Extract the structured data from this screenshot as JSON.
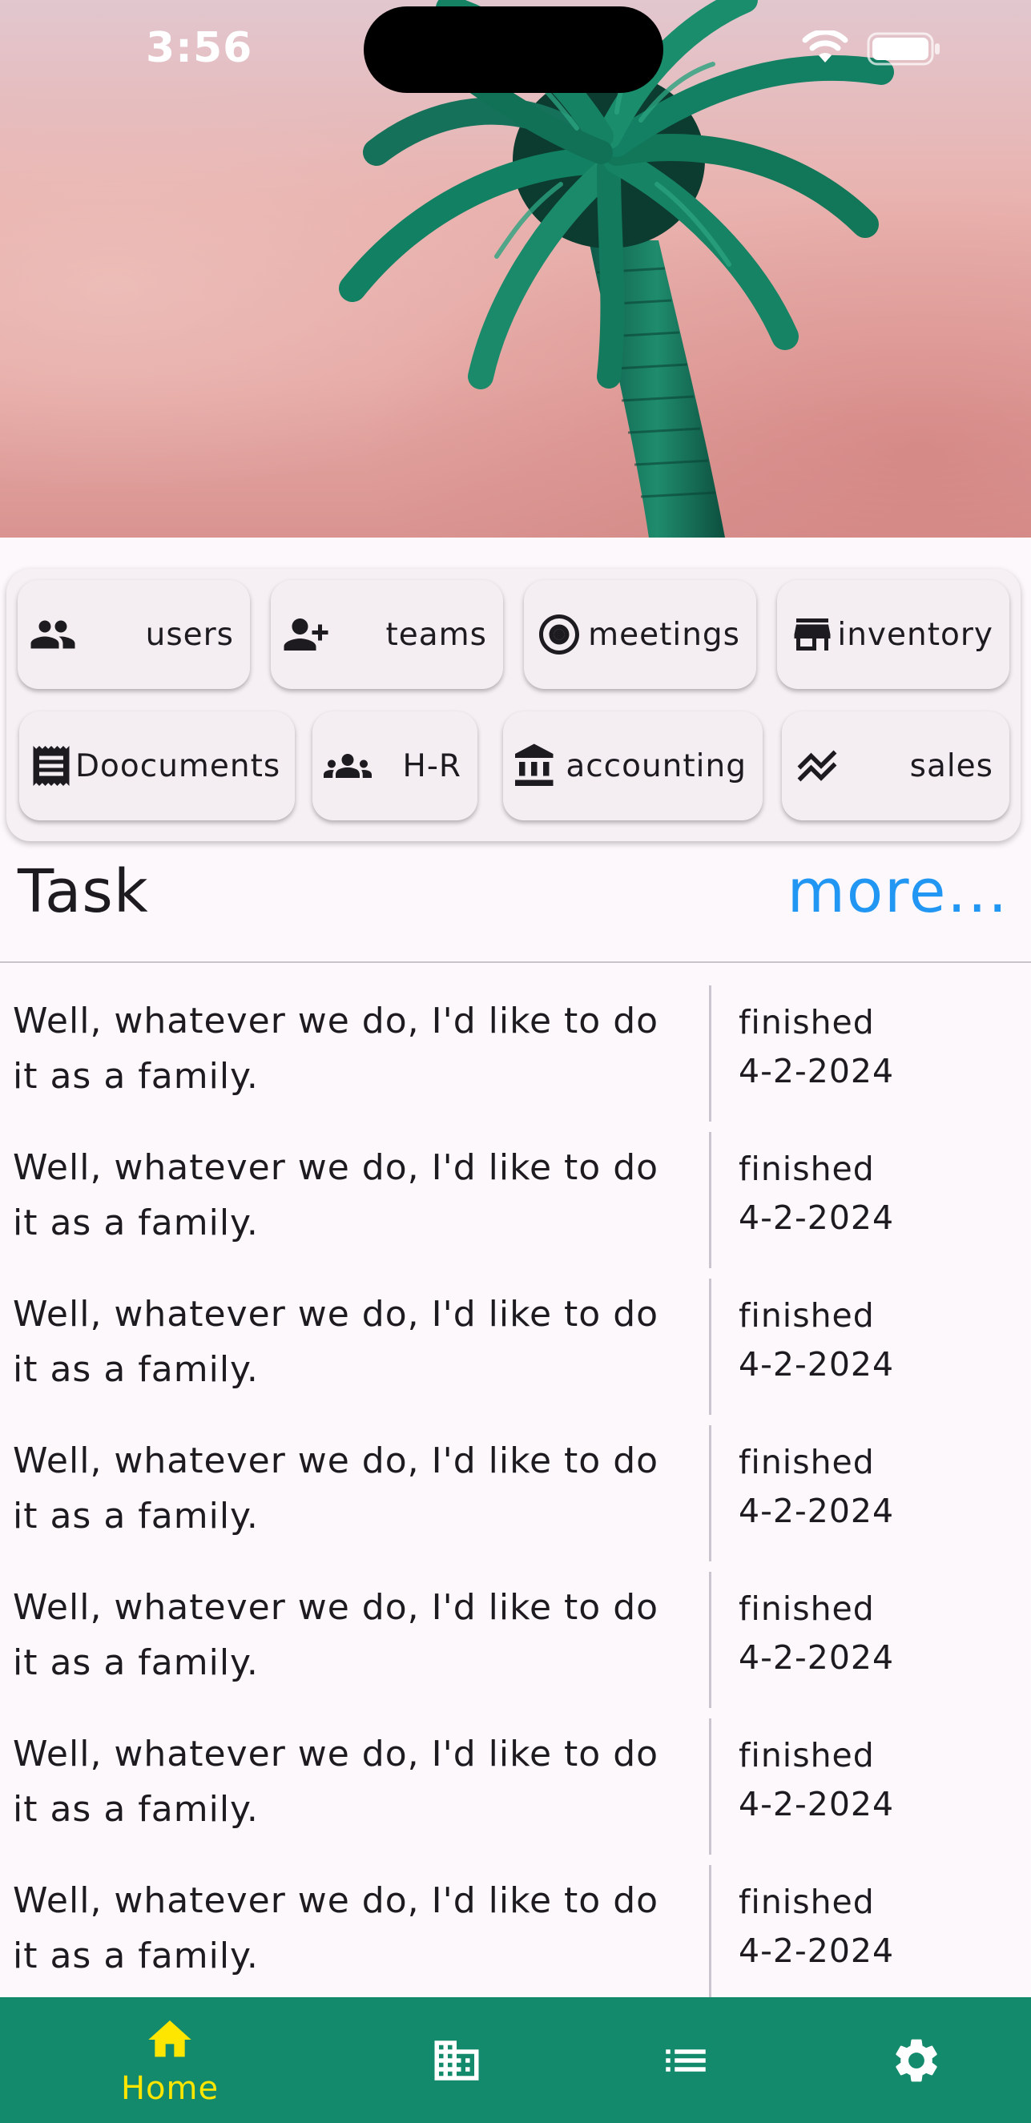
{
  "status_bar": {
    "time": "3:56"
  },
  "quick_actions": {
    "row1": [
      {
        "label": "users",
        "icon": "users-icon"
      },
      {
        "label": "teams",
        "icon": "person-add-icon"
      },
      {
        "label": "meetings",
        "icon": "radio-target-icon"
      },
      {
        "label": "inventory",
        "icon": "store-icon"
      }
    ],
    "row2": [
      {
        "label": "Doocuments",
        "icon": "receipt-icon"
      },
      {
        "label": "H-R",
        "icon": "groups-icon"
      },
      {
        "label": "accounting",
        "icon": "bank-icon"
      },
      {
        "label": "sales",
        "icon": "stacked-line-icon"
      }
    ]
  },
  "task_section": {
    "title": "Task",
    "more_label": "more...",
    "tasks": [
      {
        "text": "Well, whatever we do, I'd like to do it as a family.",
        "status": "finished",
        "date": "4-2-2024"
      },
      {
        "text": "Well, whatever we do, I'd like to do it as a family.",
        "status": "finished",
        "date": "4-2-2024"
      },
      {
        "text": "Well, whatever we do, I'd like to do it as a family.",
        "status": "finished",
        "date": "4-2-2024"
      },
      {
        "text": "Well, whatever we do, I'd like to do it as a family.",
        "status": "finished",
        "date": "4-2-2024"
      },
      {
        "text": "Well, whatever we do, I'd like to do it as a family.",
        "status": "finished",
        "date": "4-2-2024"
      },
      {
        "text": "Well, whatever we do, I'd like to do it as a family.",
        "status": "finished",
        "date": "4-2-2024"
      },
      {
        "text": "Well, whatever we do, I'd like to do it as a family.",
        "status": "finished",
        "date": "4-2-2024"
      }
    ]
  },
  "bottom_nav": {
    "items": [
      {
        "label": "Home",
        "icon": "home-icon",
        "active": true
      },
      {
        "label": "",
        "icon": "business-icon",
        "active": false
      },
      {
        "label": "",
        "icon": "list-icon",
        "active": false
      },
      {
        "label": "",
        "icon": "gear-icon",
        "active": false
      }
    ]
  },
  "colors": {
    "nav_background": "#138a6b",
    "nav_active": "#ffe600",
    "link": "#2196f3"
  }
}
